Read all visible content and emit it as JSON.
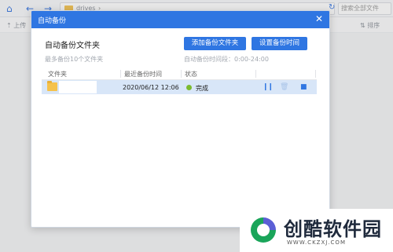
{
  "background": {
    "path_text": "drives",
    "search_placeholder": "搜索全部文件",
    "toolbar": {
      "upload": "上传",
      "sort": "排序"
    }
  },
  "dialog": {
    "title": "自动备份",
    "section_title": "自动备份文件夹",
    "hint": "最多备份10个文件夹",
    "add_button": "添加备份文件夹",
    "set_time_button": "设置备份时间",
    "time_info": "自动备份时间段：0:00-24:00",
    "table": {
      "columns": [
        "文件夹",
        "最近备份时间",
        "状态"
      ],
      "rows": [
        {
          "folder": "",
          "last_backup": "2020/06/12 12:06",
          "status": "完成"
        }
      ]
    }
  },
  "watermark": {
    "title": "创酷软件园",
    "url": "WWW.CKZXJ.COM"
  },
  "colors": {
    "accent": "#2f76e2",
    "row_selected": "#d8e6f8",
    "status_ok": "#7cbb2f"
  }
}
